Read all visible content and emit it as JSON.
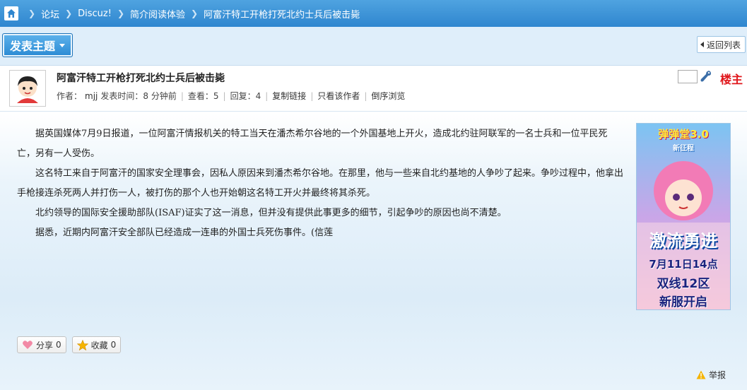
{
  "breadcrumb": {
    "items": [
      "论坛",
      "Discuz!",
      "简介阅读体验",
      "阿富汗特工开枪打死北约士兵后被击毙"
    ]
  },
  "toolbar": {
    "post_label": "发表主题",
    "back_label": "返回列表"
  },
  "post": {
    "title": "阿富汗特工开枪打死北约士兵后被击毙",
    "meta": {
      "author_label": "作者：",
      "author": "mjj",
      "time_label": "发表时间：",
      "time": "8 分钟前",
      "views_label": "查看：",
      "views": "5",
      "replies_label": "回复：",
      "replies": "4",
      "copy_link": "复制链接",
      "author_only": "只看该作者",
      "reverse": "倒序浏览"
    },
    "floor_label": "楼主",
    "paragraphs": [
      "据英国媒体7月9日报道，一位阿富汗情报机关的特工当天在潘杰希尔谷地的一个外国基地上开火，造成北约驻阿联军的一名士兵和一位平民死亡，另有一人受伤。",
      "这名特工来自于阿富汗的国家安全理事会，因私人原因来到潘杰希尔谷地。在那里，他与一些来自北约基地的人争吵了起来。争吵过程中，他拿出手枪接连杀死两人并打伤一人，被打伤的那个人也开始朝这名特工开火并最终将其杀死。",
      "北约领导的国际安全援助部队(ISAF)证实了这一消息，但并没有提供此事更多的细节，引起争吵的原因也尚不清楚。",
      "据悉，近期内阿富汗安全部队已经造成一连串的外国士兵死伤事件。(信莲"
    ],
    "ad": {
      "title": "弹弹堂3.0",
      "subtitle": "新征程",
      "slogan": "激流勇进",
      "date": "7月11日14点",
      "line2": "双线12区",
      "line3": "新服开启"
    }
  },
  "actions": {
    "share_label": "分享",
    "share_count": "0",
    "fav_label": "收藏",
    "fav_count": "0",
    "report_label": "举报"
  },
  "colors": {
    "bar_blue": "#2f86cf",
    "floor_red": "#e0161b"
  }
}
